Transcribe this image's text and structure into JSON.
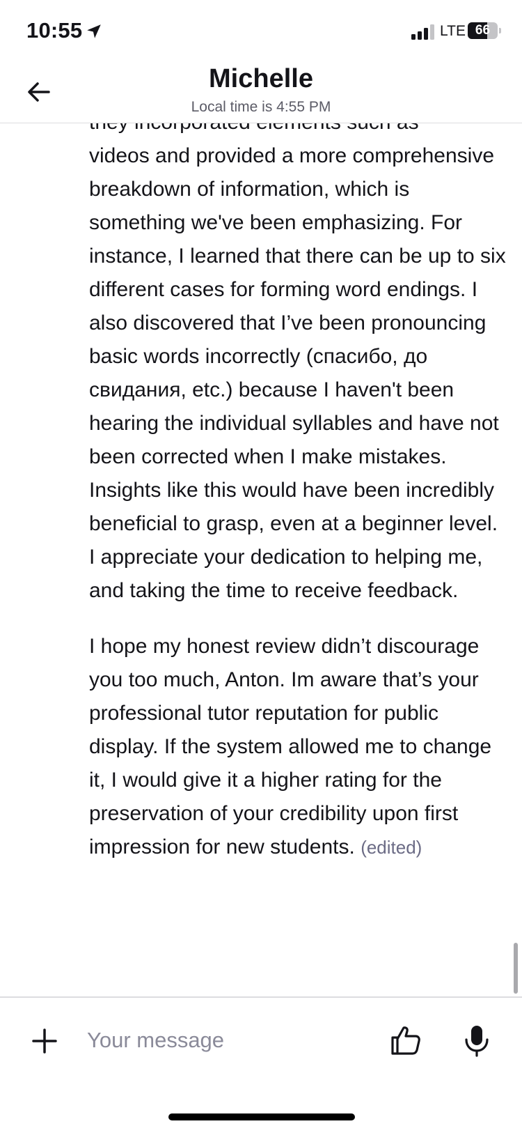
{
  "status_bar": {
    "time": "10:55",
    "network": "LTE",
    "battery": "66",
    "battery_level": 0.66
  },
  "header": {
    "back_icon": "arrow-left-icon",
    "name": "Michelle",
    "local_time": "Local time is 4:55 PM"
  },
  "message": {
    "partial_top_line": "they incorporated elements such as",
    "paragraphs": [
      "videos and provided a more comprehensive breakdown of information, which is something we've been emphasizing. For instance, I learned that there can be up to six different cases for forming word endings. I also discovered that I’ve been pronouncing basic words incorrectly (спасибо, до свидания, etc.) because I haven't been hearing the individual syllables and have not been corrected when I make mistakes. Insights like this would have been incredibly beneficial to grasp, even at a beginner level. I appreciate your dedication to helping me, and taking the time to receive feedback.",
      "I hope my honest review didn’t discourage you too much, Anton. Im aware that’s your professional tutor reputation for public display. If the system allowed me to change it, I would give it a higher rating for the preservation of your credibility upon first impression for new students."
    ],
    "edited_label": "(edited)"
  },
  "composer": {
    "placeholder": "Your message",
    "value": "",
    "icons": {
      "add": "plus-icon",
      "like": "thumbs-up-icon",
      "mic": "microphone-icon"
    }
  }
}
